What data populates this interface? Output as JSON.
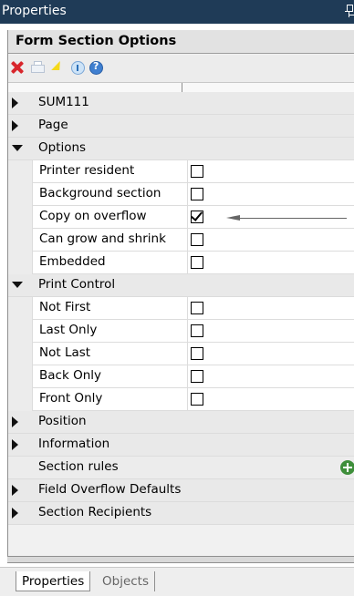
{
  "window": {
    "title": "Properties"
  },
  "panel": {
    "header": "Form Section Options"
  },
  "toolbar": {
    "icons": [
      "delete-icon",
      "print-icon",
      "lightning-icon",
      "info-icon",
      "help-icon"
    ]
  },
  "grid": {
    "rows": [
      {
        "kind": "category",
        "expanded": false,
        "label": "SUM111"
      },
      {
        "kind": "category",
        "expanded": false,
        "label": "Page"
      },
      {
        "kind": "category",
        "expanded": true,
        "label": "Options"
      },
      {
        "kind": "property",
        "label": "Printer resident",
        "checked": false
      },
      {
        "kind": "property",
        "label": "Background section",
        "checked": false
      },
      {
        "kind": "property",
        "label": "Copy on overflow",
        "checked": true
      },
      {
        "kind": "property",
        "label": "Can grow and shrink",
        "checked": false
      },
      {
        "kind": "property",
        "label": "Embedded",
        "checked": false
      },
      {
        "kind": "category",
        "expanded": true,
        "label": "Print Control"
      },
      {
        "kind": "property",
        "label": "Not First",
        "checked": false
      },
      {
        "kind": "property",
        "label": "Last Only",
        "checked": false
      },
      {
        "kind": "property",
        "label": "Not Last",
        "checked": false
      },
      {
        "kind": "property",
        "label": "Back Only",
        "checked": false
      },
      {
        "kind": "property",
        "label": "Front Only",
        "checked": false
      },
      {
        "kind": "category",
        "expanded": false,
        "label": "Position"
      },
      {
        "kind": "category",
        "expanded": false,
        "label": "Information"
      },
      {
        "kind": "plain",
        "label": "Section rules"
      },
      {
        "kind": "category",
        "expanded": false,
        "label": "Field Overflow Defaults"
      },
      {
        "kind": "category",
        "expanded": false,
        "label": "Section Recipients"
      }
    ]
  },
  "tabs": [
    {
      "label": "Properties",
      "active": true
    },
    {
      "label": "Objects",
      "active": false
    }
  ]
}
